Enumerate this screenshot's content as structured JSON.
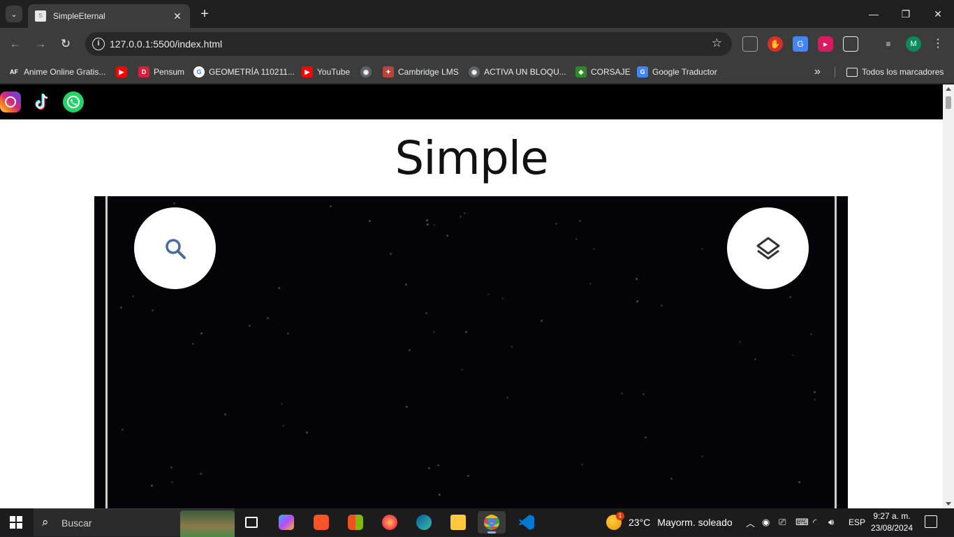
{
  "browser": {
    "tab": {
      "title": "SimpleEternal",
      "favicon_letter": "S"
    },
    "new_tab_label": "+",
    "window": {
      "minimize": "—",
      "restore": "❐",
      "close": "✕"
    },
    "toolbar": {
      "back": "←",
      "forward": "→",
      "reload": "↻",
      "url": "127.0.0.1:5500/index.html",
      "profile_initial": "M"
    },
    "bookmarks": [
      {
        "label": "Anime Online Gratis...",
        "icon": "AF",
        "color": "#222222"
      },
      {
        "label": "",
        "icon": "▶",
        "color": "#ff0000"
      },
      {
        "label": "Pensum",
        "icon": "D",
        "color": "#d81e3a"
      },
      {
        "label": "GEOMETRÍA 110211...",
        "icon": "G",
        "color": "#4285f4"
      },
      {
        "label": "YouTube",
        "icon": "▶",
        "color": "#ff0000"
      },
      {
        "label": "",
        "icon": "◉",
        "color": "#5f6368"
      },
      {
        "label": "Cambridge LMS",
        "icon": "✦",
        "color": "#b8443a"
      },
      {
        "label": "ACTIVA UN BLOQU...",
        "icon": "◉",
        "color": "#5f6368"
      },
      {
        "label": "CORSAJE",
        "icon": "◆",
        "color": "#2c8a2c"
      },
      {
        "label": "Google Traductor",
        "icon": "G",
        "color": "#4285f4"
      }
    ],
    "bookmarks_overflow": "»",
    "all_bookmarks_label": "Todos los marcadores"
  },
  "page": {
    "logo_text": "Simple",
    "hero": {
      "search_icon": "search-icon",
      "layers_icon": "layers-icon"
    },
    "social": [
      "instagram-icon",
      "tiktok-icon",
      "whatsapp-icon"
    ]
  },
  "taskbar": {
    "search_label": "Buscar",
    "weather": {
      "temp": "23°C",
      "desc": "Mayorm. soleado",
      "badge": "1"
    },
    "language": "ESP",
    "time": "9:27 a. m.",
    "date": "23/08/2024"
  }
}
